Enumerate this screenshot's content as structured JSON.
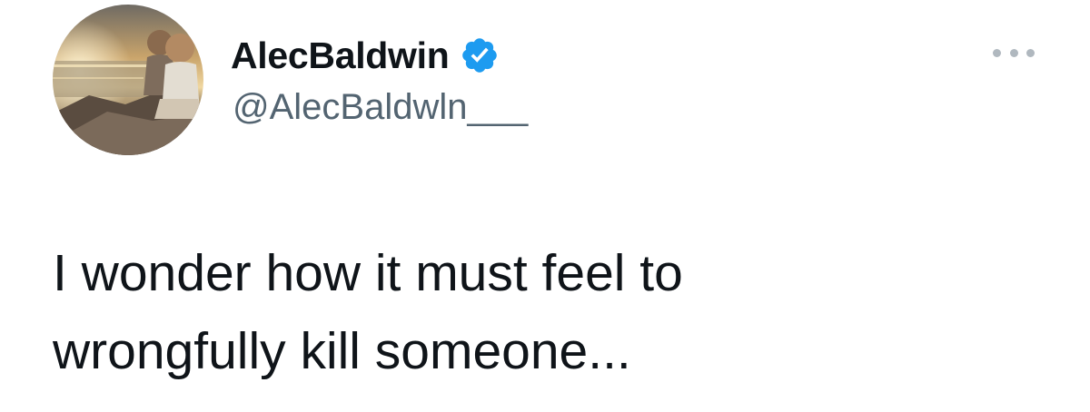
{
  "tweet": {
    "author": {
      "display_name": "AlecBaldwin",
      "handle": "@AlecBaldwln___",
      "verified": true,
      "verified_icon": "verified-badge-icon",
      "avatar_description": "avatar-photo"
    },
    "text": "I wonder how it must feel to\nwrongfully kill someone...",
    "more_icon": "more-options-icon"
  },
  "colors": {
    "name": "#0f1419",
    "handle": "#536471",
    "verified": "#1d9bf0",
    "more_dots": "#b0b8bf"
  }
}
